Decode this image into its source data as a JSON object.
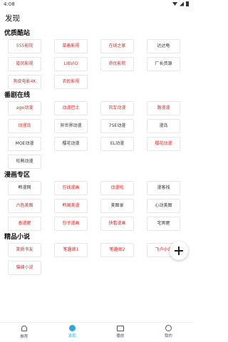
{
  "status": {
    "time": "4:08"
  },
  "header": {
    "title": "发现"
  },
  "sections": [
    {
      "title": "优质酷站",
      "items": [
        {
          "label": "555影院",
          "red": true
        },
        {
          "label": "菜着影视",
          "red": true
        },
        {
          "label": "在线之家",
          "red": true
        },
        {
          "label": "达达龟",
          "red": false
        },
        {
          "label": "旋风影视",
          "red": true
        },
        {
          "label": "LIBVIO",
          "red": true
        },
        {
          "label": "奇优影院",
          "red": true
        },
        {
          "label": "厂长资源",
          "red": false
        },
        {
          "label": "狗皮电影4K",
          "red": true
        },
        {
          "label": "农民影视",
          "red": true
        }
      ]
    },
    {
      "title": "番剧在线",
      "items": [
        {
          "label": "age动漫",
          "red": true
        },
        {
          "label": "动漫巴士",
          "red": true
        },
        {
          "label": "风车动漫",
          "red": true
        },
        {
          "label": "路漫漫",
          "red": true
        },
        {
          "label": "动漫岛",
          "red": true
        },
        {
          "label": "异世界动漫",
          "red": false
        },
        {
          "label": "7SE动漫",
          "red": false
        },
        {
          "label": "漫岛",
          "red": false
        },
        {
          "label": "MOE动漫",
          "red": false
        },
        {
          "label": "樱花动漫",
          "red": false
        },
        {
          "label": "EL动漫",
          "red": false
        },
        {
          "label": "樱花动漫",
          "red": true
        },
        {
          "label": "杜鹃动漫",
          "red": false
        }
      ]
    },
    {
      "title": "漫画专区",
      "items": [
        {
          "label": "韩漫网",
          "red": false
        },
        {
          "label": "在线漫画",
          "red": true
        },
        {
          "label": "动漫啦",
          "red": true
        },
        {
          "label": "漫客栈",
          "red": false
        },
        {
          "label": "六色美图",
          "red": true
        },
        {
          "label": "韩国美漫",
          "red": true
        },
        {
          "label": "美图录",
          "red": false
        },
        {
          "label": "心动美图",
          "red": false
        },
        {
          "label": "香漫屋",
          "red": true
        },
        {
          "label": "包子漫画",
          "red": true
        },
        {
          "label": "快看漫画",
          "red": true
        },
        {
          "label": "宅男屋",
          "red": false
        }
      ]
    },
    {
      "title": "精品小说",
      "items": [
        {
          "label": "笑质书友",
          "red": true
        },
        {
          "label": "笔趣阁1",
          "red": true
        },
        {
          "label": "笔趣阁2",
          "red": true
        },
        {
          "label": "飞卢小说",
          "red": true
        },
        {
          "label": "猫缝小说",
          "red": true
        }
      ]
    }
  ],
  "bottom_nav": [
    {
      "label": "推荐",
      "icon": "home-icon",
      "active": false
    },
    {
      "label": "发现",
      "icon": "discover-icon",
      "active": true
    },
    {
      "label": "播放",
      "icon": "play-icon",
      "active": false
    },
    {
      "label": "我的",
      "icon": "profile-icon",
      "active": false
    }
  ],
  "colors": {
    "accent": "#2aa8e0",
    "link_red": "#d42a2a"
  }
}
